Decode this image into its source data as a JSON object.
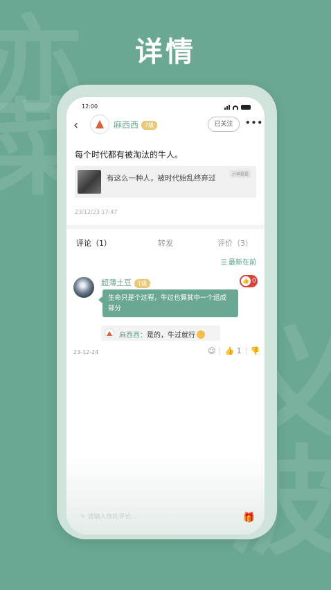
{
  "headline": "详情",
  "background_chars": [
    "亦",
    "菜",
    "义",
    "波"
  ],
  "status_bar": {
    "time": "12:00"
  },
  "nav": {
    "username": "麻西西",
    "level": "7级",
    "follow_label": "已关注",
    "more_label": "•••"
  },
  "post": {
    "text": "每个时代都有被淘汰的牛人。",
    "quote": {
      "text": "有这么一种人，被时代始乱终弃过",
      "tag": "六神磊磊"
    },
    "time": "23/12/23 17:47"
  },
  "tabs": [
    {
      "label": "评论（1）"
    },
    {
      "label": "转发"
    },
    {
      "label": "评价（3）"
    }
  ],
  "sort_label": "最新在前",
  "comment": {
    "username": "超薄土豆",
    "level": "1级",
    "like_count": "0",
    "text": "生命只是个过程，牛过也算其中一个组成部分",
    "reply": {
      "name": "麻西西：",
      "text": "是的，牛过就行"
    },
    "time": "23-12-24",
    "up_count": "1"
  },
  "input_placeholder": "请输入你的评论...",
  "colors": {
    "accent": "#6aa893",
    "badge_gold": "#e9c878",
    "like_red": "#d9423a"
  }
}
